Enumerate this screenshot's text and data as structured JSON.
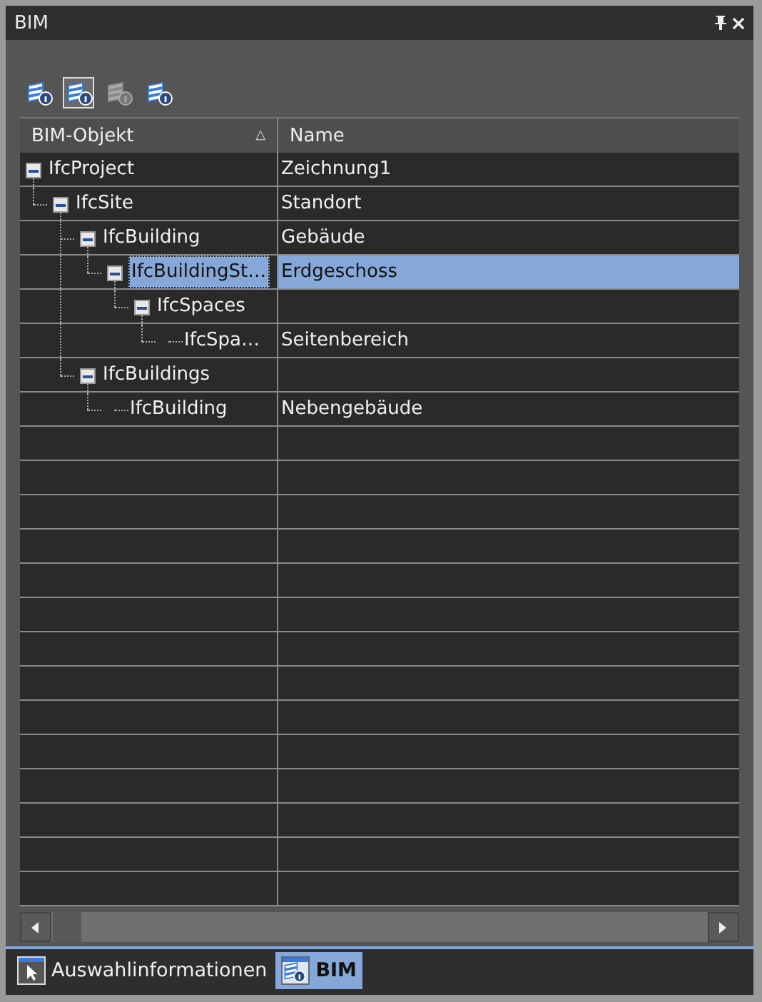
{
  "window": {
    "title": "BIM"
  },
  "toolbar": [
    {
      "selected": false,
      "disabled": false
    },
    {
      "selected": true,
      "disabled": false
    },
    {
      "selected": false,
      "disabled": true
    },
    {
      "selected": false,
      "disabled": false
    }
  ],
  "table": {
    "columns": [
      {
        "label": "BIM-Objekt",
        "sort_icon": "△"
      },
      {
        "label": "Name"
      }
    ],
    "tree": [
      {
        "object": "IfcProject",
        "name": "Zeichnung1",
        "expanded": true,
        "selected": false,
        "children": [
          {
            "object": "IfcSite",
            "name": "Standort",
            "expanded": true,
            "selected": false,
            "children": [
              {
                "object": "IfcBuilding",
                "name": "Gebäude",
                "expanded": true,
                "selected": false,
                "children": [
                  {
                    "object": "IfcBuildingSt…",
                    "name": "Erdgeschoss",
                    "expanded": true,
                    "selected": true,
                    "children": [
                      {
                        "object": "IfcSpaces",
                        "expanded": true,
                        "selected": false,
                        "children": [
                          {
                            "object": "IfcSpa…",
                            "name": "Seitenbereich",
                            "selected": false
                          }
                        ]
                      }
                    ]
                  }
                ]
              },
              {
                "object": "IfcBuildings",
                "expanded": true,
                "selected": false,
                "children": [
                  {
                    "object": "IfcBuilding",
                    "name": "Nebengebäude",
                    "selected": false
                  }
                ]
              }
            ]
          }
        ]
      }
    ]
  },
  "tabs": [
    {
      "label": "Auswahlinformationen",
      "selected": false,
      "kind": "cursor"
    },
    {
      "label": "BIM",
      "selected": true,
      "kind": "bim"
    }
  ]
}
